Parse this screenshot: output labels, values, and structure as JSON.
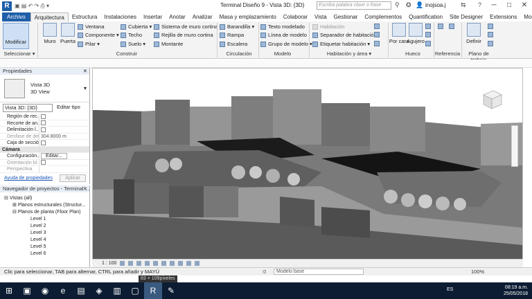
{
  "titlebar": {
    "app_logo": "R",
    "document_title": "Terminal Diseño 9 - Vista 3D: {3D}",
    "search_placeholder": "Escriba palabra clave o frase",
    "user": "inojsoa.j",
    "minimize": "─",
    "maximize": "□",
    "close": "✕"
  },
  "tabs": [
    "Archivo",
    "Arquitectura",
    "Estructura",
    "Instalaciones",
    "Insertar",
    "Anotar",
    "Analizar",
    "Masa y emplazamiento",
    "Colaborar",
    "Vista",
    "Gestionar",
    "Complementos",
    "Quantification",
    "Site Designer",
    "Extensions",
    "Modificar"
  ],
  "active_tab": "Arquitectura",
  "ribbon": {
    "modify": "Modificar",
    "muro": "Muro",
    "puerta": "Puerta",
    "build_small": [
      "Ventana",
      "Componente",
      "Pilar",
      "Cubierta",
      "Techo",
      "Suelo",
      "Sistema de muro cortina",
      "Rejilla de muro cortina",
      "Montante"
    ],
    "circ_small": [
      "Barandilla",
      "Rampa",
      "Escalera"
    ],
    "model_small": [
      "Texto modelado",
      "Línea de modelo",
      "Grupo de modelo"
    ],
    "room_small": [
      "Habitación",
      "Separador de habitación",
      "Etiquetar habitación"
    ],
    "porcara": "Por cara",
    "agujero": "Agujero",
    "definir": "Definir",
    "groups": {
      "seleccionar": "Seleccionar ▾",
      "construir": "Construir",
      "circulacion": "Circulación",
      "modelo": "Modelo",
      "habitacion": "Habitación y área ▾",
      "hueco": "Hueco",
      "referencia": "Referencia",
      "plano": "Plano de trabajo"
    }
  },
  "properties": {
    "header": "Propiedades",
    "type_line1": "Vista 3D",
    "type_line2": "3D View",
    "view_selector": "Vista 3D: {3D}",
    "edit_type": "Editar tipo",
    "rows": [
      {
        "k": "Región de rec...",
        "v": ""
      },
      {
        "k": "Recorte de an...",
        "v": ""
      },
      {
        "k": "Delimitación l...",
        "v": ""
      },
      {
        "k": "Desfase de del...",
        "v": "304.8000 m"
      },
      {
        "k": "Caja de sección",
        "v": ""
      }
    ],
    "category": "Cámara",
    "camera_rows": [
      {
        "k": "Configuración...",
        "v": "Editar..."
      },
      {
        "k": "Orientación bl...",
        "v": ""
      },
      {
        "k": "Perspectiva",
        "v": ""
      }
    ],
    "help_link": "Ayuda de propiedades",
    "apply": "Aplicar"
  },
  "browser": {
    "header": "Navegador de proyectos - Terminal ...",
    "items": [
      {
        "label": "Vistas (all)",
        "level": 0
      },
      {
        "label": "Planos estructurales (Structur...",
        "level": 1
      },
      {
        "label": "Planos de planta (Floor Plan)",
        "level": 1
      },
      {
        "label": "Level 1",
        "level": 2
      },
      {
        "label": "Level 2",
        "level": 2
      },
      {
        "label": "Level 3",
        "level": 2
      },
      {
        "label": "Level 4",
        "level": 2
      },
      {
        "label": "Level 5",
        "level": 2
      },
      {
        "label": "Level 6",
        "level": 2
      }
    ]
  },
  "viewport": {
    "scale": "1 : 100"
  },
  "statusbar": {
    "text": "Clic para seleccionar, TAB para alternar, CTRL para añadir y MAYÚ",
    "zero": ":0",
    "model": "Modelo base",
    "zoom": "100%",
    "floating": "83 × 109píxeles"
  },
  "taskbar": {
    "lang": "ES",
    "time": "08:19 a.m.",
    "date": "25/05/2018"
  },
  "colors": {
    "brand_blue": "#1f5fa8",
    "taskbar": "#0c1d33"
  }
}
